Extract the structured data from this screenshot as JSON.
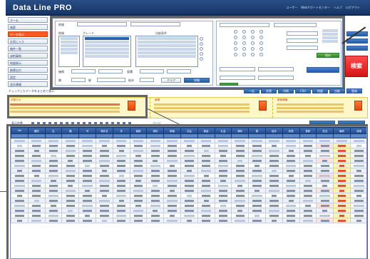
{
  "app": {
    "title": "Data Line PRO"
  },
  "header": {
    "links": [
      "ユーザー",
      "Webサポートセンター",
      "ヘルプ",
      "ログアウト"
    ]
  },
  "nav": {
    "items": [
      {
        "label": "ホーム"
      },
      {
        "label": "検索"
      },
      {
        "label": "データ表示"
      },
      {
        "label": "お気に入り"
      },
      {
        "label": "物件一覧"
      },
      {
        "label": "成約事例"
      },
      {
        "label": "地図表示"
      },
      {
        "label": "帳票出力"
      },
      {
        "label": "設定"
      },
      {
        "label": "会社情報"
      }
    ]
  },
  "search": {
    "area_label": "地域",
    "grade_label": "グレード",
    "condition_label": "比較条件",
    "area_options": [
      "東京都",
      "神奈川県",
      "埼玉県",
      "千葉県",
      "大阪府",
      "愛知県"
    ],
    "grade_options": [
      "S",
      "A",
      "B",
      "C",
      "D"
    ],
    "price_label": "価格",
    "area_size_label": "面積",
    "floor_label": "階",
    "station_label": "駅",
    "walk_label": "徒歩",
    "clear_label": "クリア",
    "detail_label": "詳細",
    "save_label": "保存",
    "search_label": "検索"
  },
  "toolbar": {
    "left_text": "チェックしたデータをまとめて表示",
    "buttons": [
      "一括",
      "並替",
      "印刷",
      "CSV",
      "地図",
      "比較",
      "登録"
    ]
  },
  "info": {
    "box1_title": "お知らせ",
    "box2_title": "新着",
    "box3_title": "更新情報"
  },
  "grid": {
    "tools": [
      "表示件数",
      "ページ"
    ],
    "columns": [
      "No",
      "種別",
      "区",
      "階",
      "号",
      "物件名",
      "坪",
      "面積",
      "賃料",
      "単価",
      "共益",
      "敷金",
      "礼金",
      "築年",
      "駅",
      "徒歩",
      "状態",
      "更新",
      "担当",
      "備考",
      "詳細"
    ],
    "rows": [
      [
        "",
        "",
        "",
        "",
        "",
        "",
        "",
        "",
        "",
        "",
        "",
        "",
        "",
        "",
        "",
        "",
        "",
        "",
        "",
        "",
        ""
      ]
    ],
    "row_count": 16
  },
  "colors": {
    "header": "#1f4177",
    "accent": "#ff5a1f",
    "search_button": "#d21414",
    "info_bg": "#fff7c7",
    "table_header": "#2b5597"
  }
}
